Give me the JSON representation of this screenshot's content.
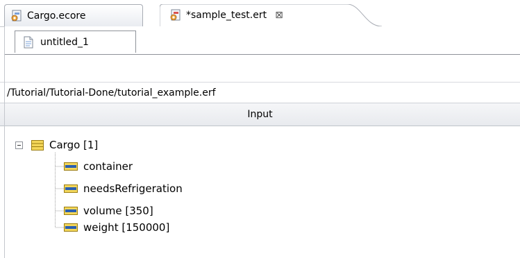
{
  "editor_tabs": [
    {
      "label": "Cargo.ecore",
      "icon": "ecore-file-icon",
      "active": false
    },
    {
      "label": "*sample_test.ert",
      "icon": "ert-file-icon",
      "active": true,
      "close_glyph": "⊠"
    }
  ],
  "page_tabs": [
    {
      "label": "untitled_1",
      "icon": "document-icon"
    }
  ],
  "path": "/Tutorial/Tutorial-Done/tutorial_example.erf",
  "input_header": "Input",
  "tree": {
    "root": {
      "label": "Cargo [1]",
      "icon": "eclass-icon",
      "expanded": true,
      "toggle_glyph": "−"
    },
    "children": [
      {
        "label": "container",
        "icon": "eattribute-icon"
      },
      {
        "label": "needsRefrigeration",
        "icon": "eattribute-icon"
      },
      {
        "label": "volume [350]",
        "icon": "eattribute-icon"
      },
      {
        "label": "weight [150000]",
        "icon": "eattribute-icon"
      }
    ]
  },
  "colors": {
    "class_icon_yellow": "#f4d75a",
    "attr_icon_blue": "#2a5fb0",
    "frame_gray": "#c4c7cd"
  }
}
